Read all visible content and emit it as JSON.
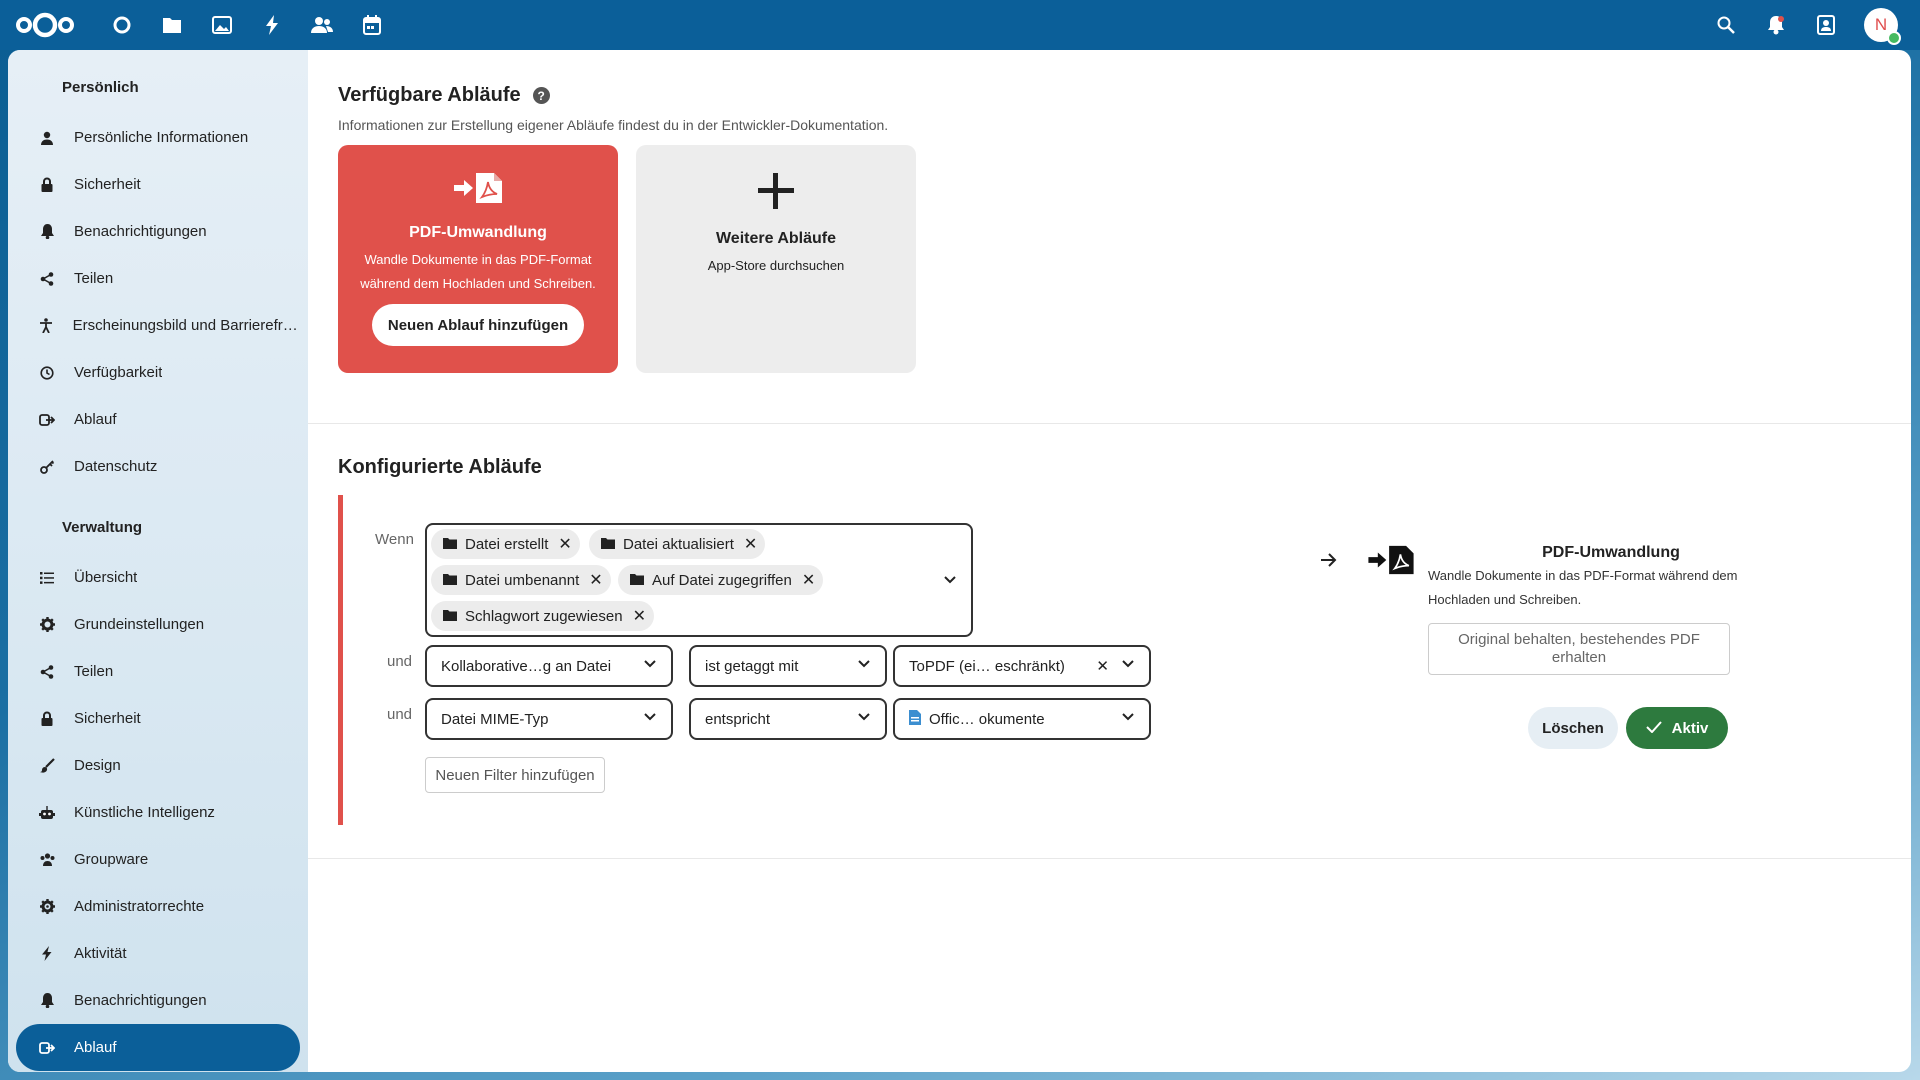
{
  "topbar": {
    "apps": [
      "dashboard-icon",
      "files-icon",
      "photos-icon",
      "activity-icon",
      "contacts-icon",
      "calendar-icon"
    ],
    "right": [
      "search-icon",
      "notifications-icon",
      "contacts-menu-icon"
    ],
    "avatar_letter": "N"
  },
  "sidebar": {
    "personal_title": "Persönlich",
    "personal_items": [
      {
        "label": "Persönliche Informationen",
        "icon": "user-icon"
      },
      {
        "label": "Sicherheit",
        "icon": "lock-icon"
      },
      {
        "label": "Benachrichtigungen",
        "icon": "bell-icon"
      },
      {
        "label": "Teilen",
        "icon": "share-icon"
      },
      {
        "label": "Erscheinungsbild und Barrierefreiheit",
        "icon": "accessibility-icon"
      },
      {
        "label": "Verfügbarkeit",
        "icon": "clock-icon"
      },
      {
        "label": "Ablauf",
        "icon": "flow-icon"
      },
      {
        "label": "Datenschutz",
        "icon": "key-icon"
      }
    ],
    "admin_title": "Verwaltung",
    "admin_items": [
      {
        "label": "Übersicht",
        "icon": "list-icon"
      },
      {
        "label": "Grundeinstellungen",
        "icon": "gear-icon"
      },
      {
        "label": "Teilen",
        "icon": "share-icon"
      },
      {
        "label": "Sicherheit",
        "icon": "lock-icon"
      },
      {
        "label": "Design",
        "icon": "brush-icon"
      },
      {
        "label": "Künstliche Intelligenz",
        "icon": "robot-icon"
      },
      {
        "label": "Groupware",
        "icon": "groupware-icon"
      },
      {
        "label": "Administratorrechte",
        "icon": "admin-gear-icon"
      },
      {
        "label": "Aktivität",
        "icon": "activity-icon"
      },
      {
        "label": "Benachrichtigungen",
        "icon": "bell-icon"
      },
      {
        "label": "Ablauf",
        "icon": "flow-icon",
        "active": true
      }
    ]
  },
  "available": {
    "title": "Verfügbare Abläufe",
    "description": "Informationen zur Erstellung eigener Abläufe findest du in der Entwickler-Dokumentation.",
    "card_pdf": {
      "title": "PDF-Umwandlung",
      "text": "Wandle Dokumente in das PDF-Format während dem Hochladen und Schreiben.",
      "button": "Neuen Ablauf hinzufügen"
    },
    "card_more": {
      "title": "Weitere Abläufe",
      "text": "App-Store durchsuchen"
    }
  },
  "configured": {
    "title": "Konfigurierte Abläufe",
    "when_label": "Wenn",
    "and_label": "und",
    "events": [
      "Datei erstellt",
      "Datei aktualisiert",
      "Datei umbenannt",
      "Auf Datei zugegriffen",
      "Schlagwort zugewiesen"
    ],
    "checks": [
      {
        "subject": "Kollaborative…g an Datei",
        "operator": "ist getaggt mit",
        "value": "ToPDF (ei… eschränkt)"
      },
      {
        "subject": "Datei MIME-Typ",
        "operator": "entspricht",
        "value": "Offic… okumente"
      }
    ],
    "add_filter": "Neuen Filter hinzufügen",
    "action": {
      "title": "PDF-Umwandlung",
      "description": "Wandle Dokumente in das PDF-Format während dem Hochladen und Schreiben.",
      "option": "Original behalten, bestehendes PDF erhalten",
      "delete_label": "Löschen",
      "active_label": "Aktiv"
    }
  },
  "colors": {
    "brand": "#0b5f99",
    "accent_red": "#e0514b",
    "active_green": "#2d7a3e"
  }
}
